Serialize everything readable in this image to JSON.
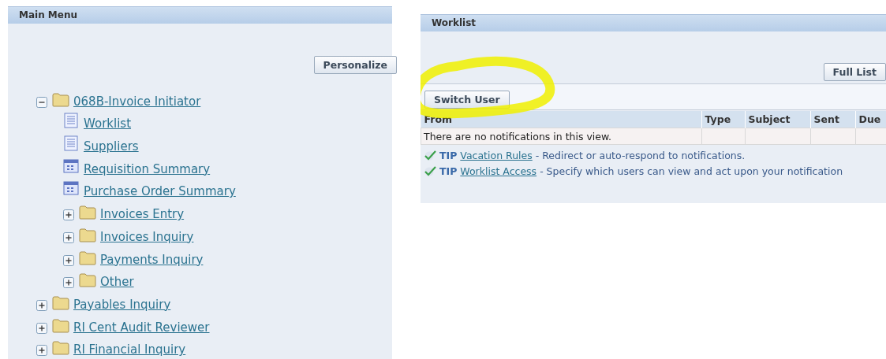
{
  "main_menu": {
    "title": "Main Menu",
    "personalize_button": "Personalize",
    "tree": [
      {
        "kind": "folder",
        "label": "068B-Invoice Initiator",
        "expanded": true,
        "children": [
          {
            "kind": "page",
            "label": "Worklist"
          },
          {
            "kind": "page",
            "label": "Suppliers"
          },
          {
            "kind": "form",
            "label": "Requisition Summary"
          },
          {
            "kind": "form",
            "label": "Purchase Order Summary"
          },
          {
            "kind": "folder",
            "label": "Invoices Entry",
            "expanded": false
          },
          {
            "kind": "folder",
            "label": "Invoices Inquiry",
            "expanded": false
          },
          {
            "kind": "folder",
            "label": "Payments Inquiry",
            "expanded": false
          },
          {
            "kind": "folder",
            "label": "Other",
            "expanded": false
          }
        ]
      },
      {
        "kind": "folder",
        "label": "Payables Inquiry",
        "expanded": false
      },
      {
        "kind": "folder",
        "label": "RI Cent Audit Reviewer",
        "expanded": false
      },
      {
        "kind": "folder",
        "label": "RI Financial Inquiry",
        "expanded": false
      }
    ]
  },
  "worklist": {
    "title": "Worklist",
    "full_list_button": "Full List",
    "switch_user_button": "Switch User",
    "highlighted": true,
    "table": {
      "columns": [
        "From",
        "Type",
        "Subject",
        "Sent",
        "Due"
      ],
      "empty_message": "There are no notifications in this view."
    },
    "tips": [
      {
        "label": "TIP",
        "link": "Vacation Rules",
        "text": "- Redirect or auto-respond to notifications."
      },
      {
        "label": "TIP",
        "link": "Worklist Access",
        "text": "- Specify which users can view and act upon your notification"
      }
    ]
  }
}
